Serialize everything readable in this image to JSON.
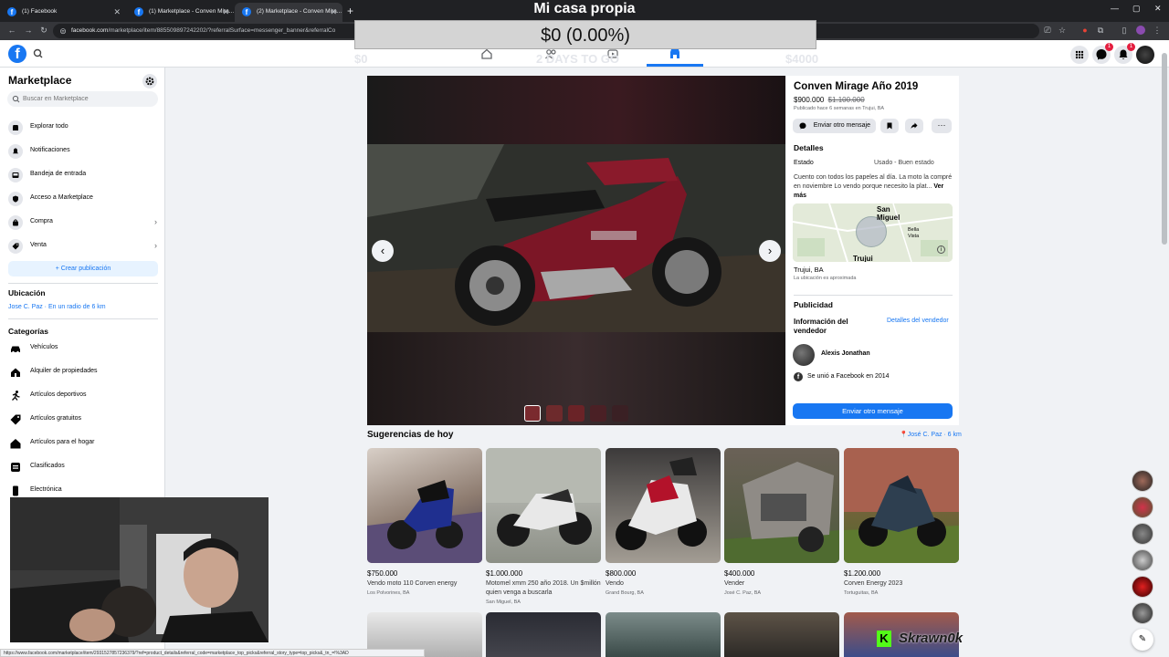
{
  "browser": {
    "tabs": [
      {
        "label": "(1) Facebook",
        "active": false
      },
      {
        "label": "(1) Marketplace - Conven Mira...",
        "active": false
      },
      {
        "label": "(2) Marketplace - Conven Mira...",
        "active": true
      }
    ],
    "url_domain": "facebook.com",
    "url_path": "/marketplace/item/885509897242202/?referralSurface=messenger_banner&referralCo"
  },
  "overlay": {
    "title": "Mi casa propia",
    "amount": "$0 (0.00%)",
    "ghost_left": "$0",
    "ghost_days": "2 DAYS TO GO",
    "ghost_right": "$4000"
  },
  "topbar": {
    "messenger_badge": "1",
    "notifications_badge": "1"
  },
  "sidebar": {
    "title": "Marketplace",
    "search_placeholder": "Buscar en Marketplace",
    "nav": [
      {
        "label": "Explorar todo",
        "icon": "store-icon"
      },
      {
        "label": "Notificaciones",
        "icon": "bell-icon"
      },
      {
        "label": "Bandeja de entrada",
        "icon": "inbox-icon"
      },
      {
        "label": "Acceso a Marketplace",
        "icon": "shield-icon"
      },
      {
        "label": "Compra",
        "icon": "bag-icon"
      },
      {
        "label": "Venta",
        "icon": "tag-icon"
      }
    ],
    "create_label": "+ Crear publicación",
    "location_heading": "Ubicación",
    "location_value": "Jose C. Paz · En un radio de 6 km",
    "categories_heading": "Categorías",
    "categories": [
      {
        "label": "Vehículos",
        "icon": "car-icon"
      },
      {
        "label": "Alquiler de propiedades",
        "icon": "house-key-icon"
      },
      {
        "label": "Artículos deportivos",
        "icon": "runner-icon"
      },
      {
        "label": "Artículos gratuitos",
        "icon": "free-tag-icon"
      },
      {
        "label": "Artículos para el hogar",
        "icon": "home-icon"
      },
      {
        "label": "Clasificados",
        "icon": "classifieds-icon"
      },
      {
        "label": "Electrónica",
        "icon": "phone-icon"
      }
    ]
  },
  "listing": {
    "title": "Conven Mirage Año 2019",
    "price": "$900.000",
    "old_price": "$1.100.000",
    "posted": "Publicado hace 6 semanas en Trujui, BA",
    "message_btn": "Enviar otro mensaje",
    "details_heading": "Detalles",
    "estado_label": "Estado",
    "estado_value": "Usado - Buen estado",
    "description": "Cuento con todos los papeles al día. La moto la compré en noviembre Lo vendo porque necesito la plat...",
    "ver_mas": "Ver más",
    "map_labels": {
      "city1": "San Miguel",
      "city2": "Bella Vista",
      "city3": "Trujui"
    },
    "location_city": "Trujui, BA",
    "location_note": "La ubicación es aproximada",
    "publicidad": "Publicidad",
    "seller_heading": "Información del vendedor",
    "seller_link": "Detalles del vendedor",
    "seller_name": "Alexis Jonathan",
    "joined": "Se unió a Facebook en 2014",
    "send_btn": "Enviar otro mensaje"
  },
  "suggestions": {
    "heading": "Sugerencias de hoy",
    "location": "José C. Paz · 6 km",
    "items": [
      {
        "price": "$750.000",
        "title": "Vendo moto 110 Corven energy",
        "location": "Los Polvorines, BA"
      },
      {
        "price": "$1.000.000",
        "title": "Motomel xmm 250 año 2018. Un $millón quien venga a buscarla",
        "location": "San Miguel, BA"
      },
      {
        "price": "$800.000",
        "title": "Vendo",
        "location": "Grand Bourg, BA"
      },
      {
        "price": "$400.000",
        "title": "Vender",
        "location": "José C. Paz, BA"
      },
      {
        "price": "$1.200.000",
        "title": "Corven Energy 2023",
        "location": "Tortuguitas, BA"
      }
    ]
  },
  "status_url": "https://www.facebook.com/marketplace/item/2931527857236379/?ref=product_details&referral_code=marketplace_top_picks&referral_story_type=top_picks&_tn_=!%3AD",
  "stream": {
    "kick_name": "Skrawn0k"
  }
}
